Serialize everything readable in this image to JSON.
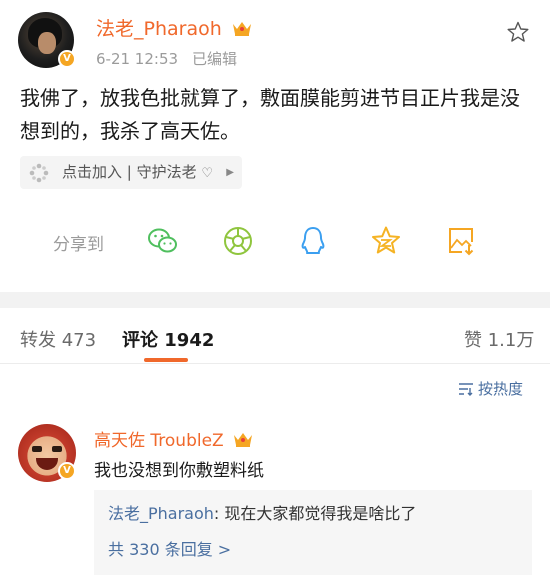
{
  "post": {
    "username": "法老_Pharaoh",
    "time": "6-21 12:53",
    "edited": "已编辑",
    "content": "我佛了，放我色批就算了，敷面膜能剪进节目正片我是没想到的，我杀了高天佐。",
    "chip": {
      "label": "点击加入 | 守护法老",
      "heart": "♡",
      "arrow": "▶"
    },
    "share_label": "分享到"
  },
  "tabs": {
    "repost": {
      "label": "转发",
      "count": "473"
    },
    "comment": {
      "label": "评论",
      "count": "1942"
    },
    "like": {
      "label": "赞",
      "count": "1.1万"
    }
  },
  "sort": {
    "label": "按热度"
  },
  "comment": {
    "username": "高天佐 TroubleZ",
    "text": "我也没想到你敷塑料纸",
    "reply": {
      "user": "法老_Pharaoh",
      "text": ": 现在大家都觉得我是啥比了",
      "more": "共 330 条回复 >"
    }
  },
  "colors": {
    "accent": "#f0682b",
    "link": "#4a6fa0",
    "verified": "#f5a623"
  },
  "icons": [
    "crown-icon",
    "star-outline-icon",
    "share-wechat-icon",
    "share-moments-icon",
    "share-qq-icon",
    "share-qzone-icon",
    "share-save-image-icon",
    "sort-icon",
    "verified-badge-icon"
  ]
}
